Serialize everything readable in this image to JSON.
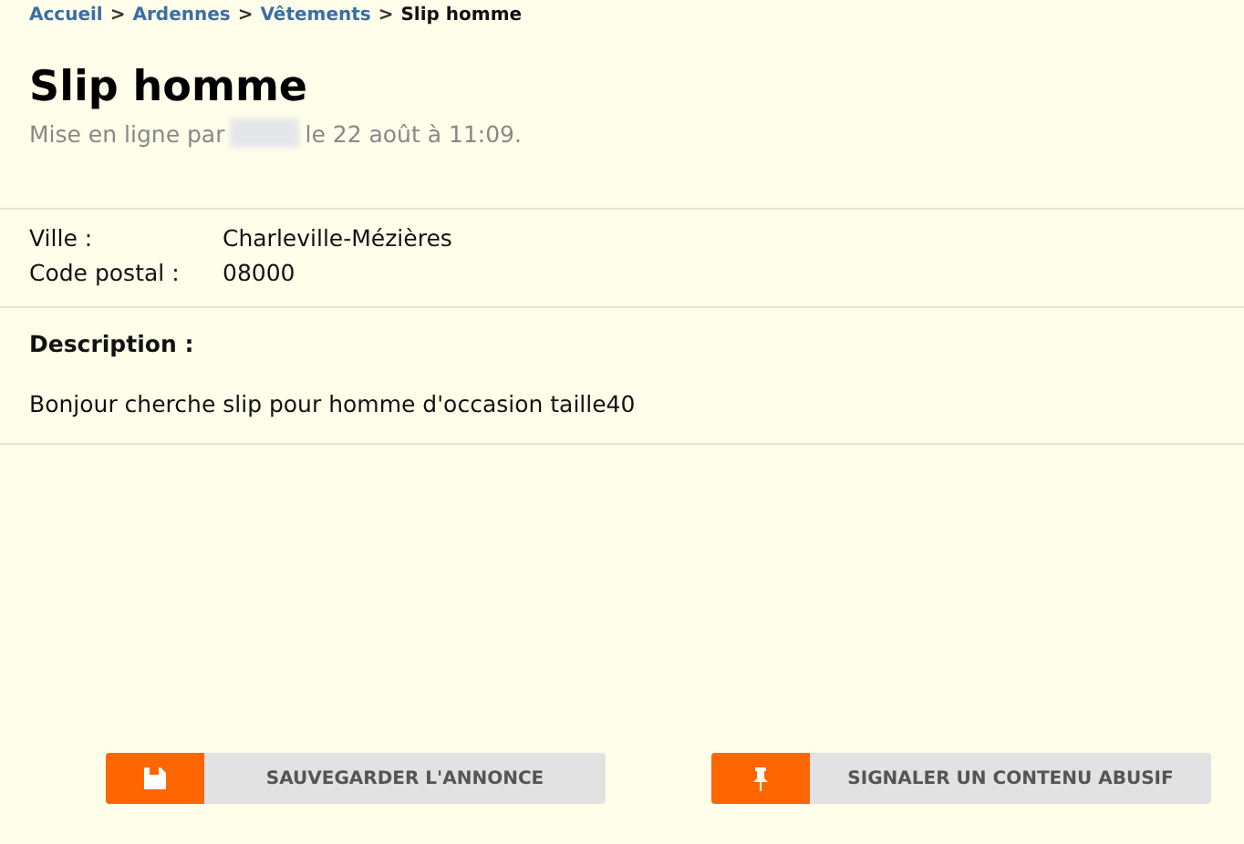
{
  "breadcrumb": [
    {
      "label": "Accueil",
      "link": true
    },
    {
      "label": "Ardennes",
      "link": true
    },
    {
      "label": "Vêtements",
      "link": true
    },
    {
      "label": "Slip homme",
      "link": false
    }
  ],
  "separator": ">",
  "title": "Slip homme",
  "posted": {
    "before": "Mise en ligne par",
    "after": "le 22 août à 11:09.",
    "author_hidden": true
  },
  "details": [
    {
      "label": "Ville :",
      "value": "Charleville-Mézières"
    },
    {
      "label": "Code postal :",
      "value": "08000"
    }
  ],
  "description": {
    "heading": "Description :",
    "text": "Bonjour cherche slip pour homme d'occasion taille40"
  },
  "actions": [
    {
      "label": "SAUVEGARDER L'ANNONCE",
      "kind": "save"
    },
    {
      "label": "SIGNALER UN CONTENU ABUSIF",
      "kind": "report"
    }
  ]
}
